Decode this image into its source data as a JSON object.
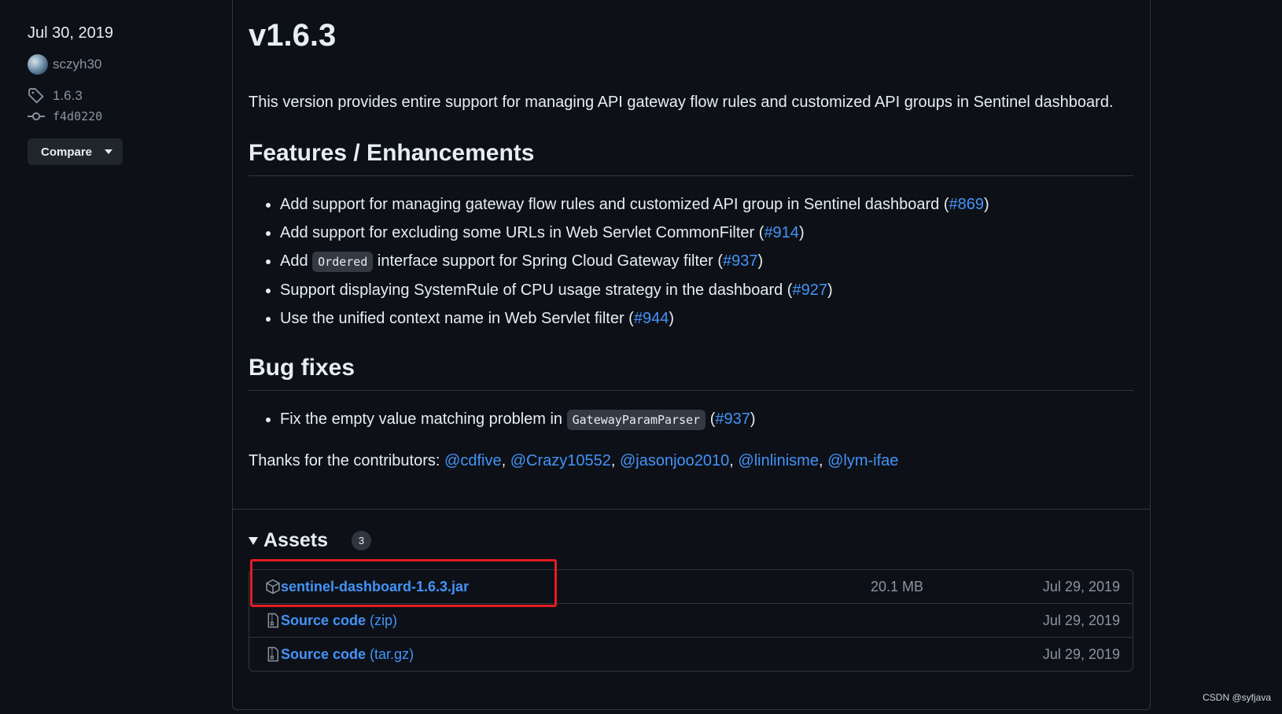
{
  "sidebar": {
    "date": "Jul 30, 2019",
    "author": "sczyh30",
    "tag": "1.6.3",
    "commit": "f4d0220",
    "compare_label": "Compare"
  },
  "release": {
    "title": "v1.6.3",
    "description": "This version provides entire support for managing API gateway flow rules and customized API groups in Sentinel dashboard.",
    "features_heading": "Features / Enhancements",
    "features": [
      {
        "pre": "Add support for managing gateway flow rules and customized API group in Sentinel dashboard (",
        "link": "#869",
        "post": ")"
      },
      {
        "pre": "Add support for excluding some URLs in Web Servlet CommonFilter (",
        "link": "#914",
        "post": ")"
      },
      {
        "pre": "Add ",
        "code": "Ordered",
        "mid": " interface support for Spring Cloud Gateway filter (",
        "link": "#937",
        "post": ")"
      },
      {
        "pre": "Support displaying SystemRule of CPU usage strategy in the dashboard (",
        "link": "#927",
        "post": ")"
      },
      {
        "pre": "Use the unified context name in Web Servlet filter (",
        "link": "#944",
        "post": ")"
      }
    ],
    "bugs_heading": "Bug fixes",
    "bugs": [
      {
        "pre": "Fix the empty value matching problem in ",
        "code": "GatewayParamParser",
        "mid": " (",
        "link": "#937",
        "post": ")"
      }
    ],
    "thanks_prefix": "Thanks for the contributors: ",
    "contributors": [
      "@cdfive",
      "@Crazy10552",
      "@jasonjoo2010",
      "@linlinisme",
      "@lym-ifae"
    ],
    "separator": ", "
  },
  "assets": {
    "title": "Assets",
    "count": "3",
    "items": [
      {
        "name": "sentinel-dashboard-1.6.3.jar",
        "ext": "",
        "size": "20.1 MB",
        "date": "Jul 29, 2019",
        "icon": "package-icon"
      },
      {
        "name": "Source code",
        "ext": " (zip)",
        "size": "",
        "date": "Jul 29, 2019",
        "icon": "file-zip-icon"
      },
      {
        "name": "Source code",
        "ext": " (tar.gz)",
        "size": "",
        "date": "Jul 29, 2019",
        "icon": "file-zip-icon"
      }
    ]
  },
  "watermark": "CSDN @syfjava",
  "colors": {
    "background": "#0d1117",
    "link": "#4493f8",
    "border": "#30363d",
    "highlight": "#e51c23"
  }
}
